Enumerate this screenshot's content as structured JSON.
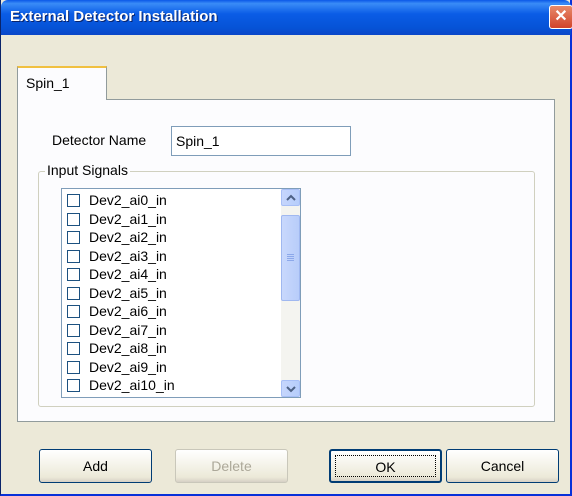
{
  "window": {
    "title": "External Detector Installation",
    "close_symbol": "✕"
  },
  "tabs": [
    {
      "label": "Spin_1",
      "selected": true
    }
  ],
  "form": {
    "detector_name_label": "Detector Name",
    "detector_name_value": "Spin_1",
    "input_signals_label": "Input Signals"
  },
  "signals": [
    {
      "label": "Dev2_ai0_in",
      "checked": false
    },
    {
      "label": "Dev2_ai1_in",
      "checked": false
    },
    {
      "label": "Dev2_ai2_in",
      "checked": false
    },
    {
      "label": "Dev2_ai3_in",
      "checked": false
    },
    {
      "label": "Dev2_ai4_in",
      "checked": false
    },
    {
      "label": "Dev2_ai5_in",
      "checked": false
    },
    {
      "label": "Dev2_ai6_in",
      "checked": false
    },
    {
      "label": "Dev2_ai7_in",
      "checked": false
    },
    {
      "label": "Dev2_ai8_in",
      "checked": false
    },
    {
      "label": "Dev2_ai9_in",
      "checked": false
    },
    {
      "label": "Dev2_ai10_in",
      "checked": false
    }
  ],
  "buttons": {
    "add": "Add",
    "delete": "Delete",
    "ok": "OK",
    "cancel": "Cancel"
  }
}
